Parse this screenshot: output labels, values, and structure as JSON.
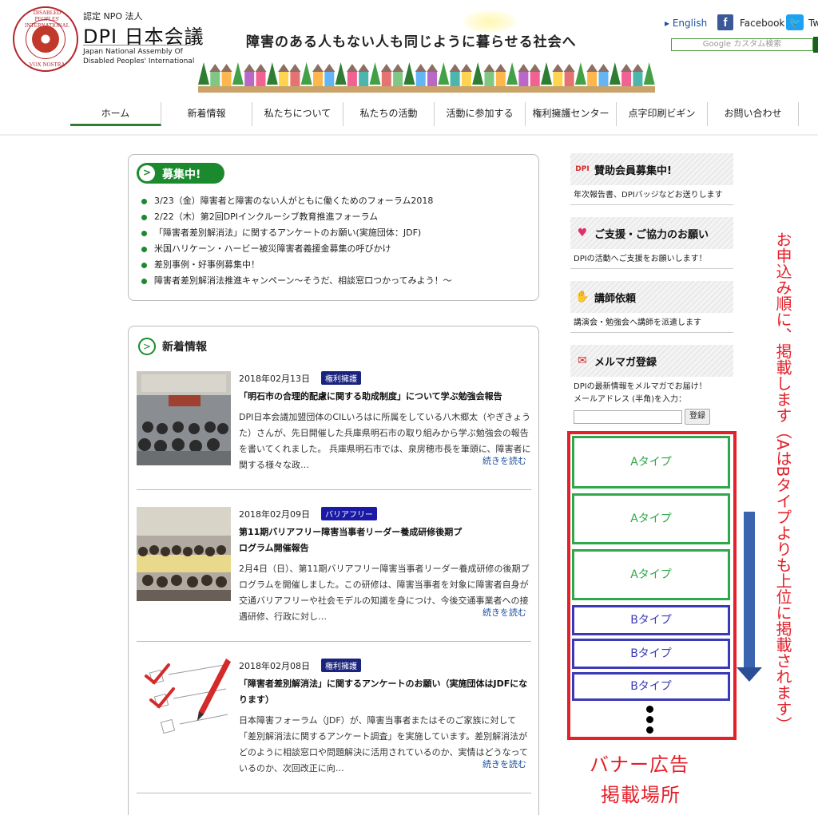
{
  "header": {
    "logo_top": "DISABLED PEOPLES' INTERNATIONAL",
    "logo_bottom": "VOX NOSTRA",
    "org_small": "認定 NPO 法人",
    "org_name": "DPI 日本会議",
    "org_en_1": "Japan National Assembly Of",
    "org_en_2": "Disabled Peoples' International",
    "tagline": "障害のある人もない人も同じように暮らせる社会へ",
    "lang_link": "English",
    "facebook_label": "Facebook",
    "twitter_label": "Tw",
    "search_placeholder": "Google カスタム検索"
  },
  "nav": {
    "items": [
      "ホーム",
      "新着情報",
      "私たちについて",
      "私たちの活動",
      "活動に参加する",
      "権利擁護センター",
      "点字印刷ビギン",
      "お問い合わせ"
    ]
  },
  "recruit": {
    "title": "募集中!",
    "items": [
      "3/23（金）障害者と障害のない人がともに働くためのフォーラム2018",
      "2/22（木）第2回DPIインクルーシブ教育推進フォーラム",
      "「障害者差別解消法」に関するアンケートのお願い(実施団体：JDF)",
      "米国ハリケーン・ハービー被災障害者義援金募集の呼びかけ",
      "差別事例・好事例募集中！",
      "障害者差別解消法推進キャンペーン～そうだ、相談窓口つかってみよう！～"
    ]
  },
  "news": {
    "title": "新着情報",
    "more_label": "続きを読む",
    "articles": [
      {
        "date": "2018年02月13日",
        "tag": "権利擁護",
        "title": "「明石市の合理的配慮に関する助成制度」について学ぶ勉強会報告",
        "body": "DPI日本会議加盟団体のCILいろはに所属をしている八木郷太（やぎきょうた）さんが、先日開催した兵庫県明石市の取り組みから学ぶ勉強会の報告を書いてくれました。 兵庫県明石市では、泉房穂市長を筆頭に、障害者に関する様々な政…"
      },
      {
        "date": "2018年02月09日",
        "tag": "バリアフリー",
        "title": "第11期バリアフリー障害当事者リーダー養成研修後期プログラム開催報告",
        "body": "2月4日（日）、第11期バリアフリー障害当事者リーダー養成研修の後期プログラムを開催しました。この研修は、障害当事者を対象に障害者自身が交通バリアフリーや社会モデルの知識を身につけ、今後交通事業者への接遇研修、行政に対し…"
      },
      {
        "date": "2018年02月08日",
        "tag": "権利擁護",
        "title": "「障害者差別解消法」に関するアンケートのお願い（実施団体はJDFになります）",
        "body": "日本障害フォーラム（JDF）が、障害当事者またはそのご家族に対して「差別解消法に関するアンケート調査」を実施しています。差別解消法がどのように相談窓口や問題解決に活用されているのか、実情はどうなっているのか、次回改正に向…"
      }
    ]
  },
  "sidebar": {
    "support": {
      "title": "賛助会員募集中!",
      "text": "年次報告書、DPIバッジなどお送りします",
      "icon_text": "DPI"
    },
    "donate": {
      "title": "ご支援・ご協力のお願い",
      "text": "DPIの活動へご支援をお願いします！"
    },
    "lecture": {
      "title": "講師依頼",
      "text": "講演会・勉強会へ講師を派遣します"
    },
    "mail": {
      "title": "メルマガ登録",
      "text1": "DPIの最新情報をメルマガでお届け！",
      "text2": "メールアドレス (半角)を入力：",
      "button": "登録"
    }
  },
  "ads": {
    "a_label": "Aタイプ",
    "b_label": "Bタイプ",
    "caption_1": "バナー広告",
    "caption_2": "掲載場所",
    "note": "お申込み順に、掲載します（AはBタイプよりも上位に掲載されます）"
  },
  "colors": {
    "accent_green": "#1b8a2e",
    "ad_red": "#e4202a",
    "ad_green": "#2ea84a",
    "ad_blue": "#3a3ab8",
    "tag_navy": "#1a237e"
  }
}
